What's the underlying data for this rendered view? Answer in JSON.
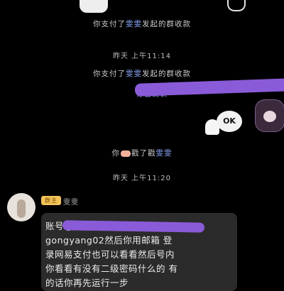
{
  "messages": {
    "system_1": {
      "prefix": "你支付了",
      "name": "雯雯",
      "suffix": "发起的群收款"
    },
    "time_1": "昨天 上午11:14",
    "system_2": {
      "prefix": "你支付了",
      "name": "雯雯",
      "suffix": "发起的群收款"
    },
    "partial_line": "你已确认",
    "sticker_text": "OK",
    "system_3": {
      "prefix": "你",
      "name": "雯雯",
      "suffix": "戳了戳"
    },
    "time_2": "昨天 上午11:20",
    "sender_badge": "群主",
    "sender_name": "雯雯",
    "bubble_lines": [
      "账号@163.com密码",
      "gongyang02然后你用邮箱 登",
      "录网易支付也可以看看然后号内",
      "你看看有没有二级密码什么的 有",
      "的话你再先运行一步"
    ]
  },
  "colors": {
    "background": "#000000",
    "highlight_name": "#8ea9ff",
    "bubble": "#2b2b2b",
    "scribble": "#8a5bd8",
    "badge": "#f3c35a"
  },
  "icons": [
    "ghost-sticker",
    "ok-sticker",
    "hand-poke-emoji",
    "avatar"
  ]
}
